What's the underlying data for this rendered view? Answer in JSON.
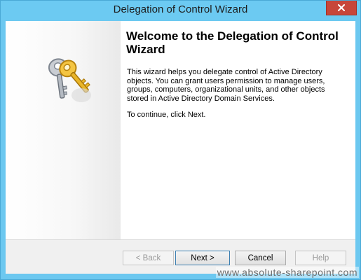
{
  "window": {
    "title": "Delegation of Control Wizard",
    "close_glyph": "x"
  },
  "banner": {
    "icon": "keys-icon"
  },
  "content": {
    "heading": "Welcome to the Delegation of Control Wizard",
    "description": "This wizard helps you delegate control of Active Directory objects. You can grant users permission to manage users, groups, computers, organizational units, and other objects stored in Active Directory Domain Services.",
    "instruction": "To continue, click Next."
  },
  "buttons": {
    "back": "< Back",
    "next": "Next >",
    "cancel": "Cancel",
    "help": "Help"
  },
  "watermark": "www.absolute-sharepoint.com",
  "colors": {
    "titlebar": "#6ccaf2",
    "close_button": "#c7463a",
    "dialog_background": "#f0f0f0"
  }
}
